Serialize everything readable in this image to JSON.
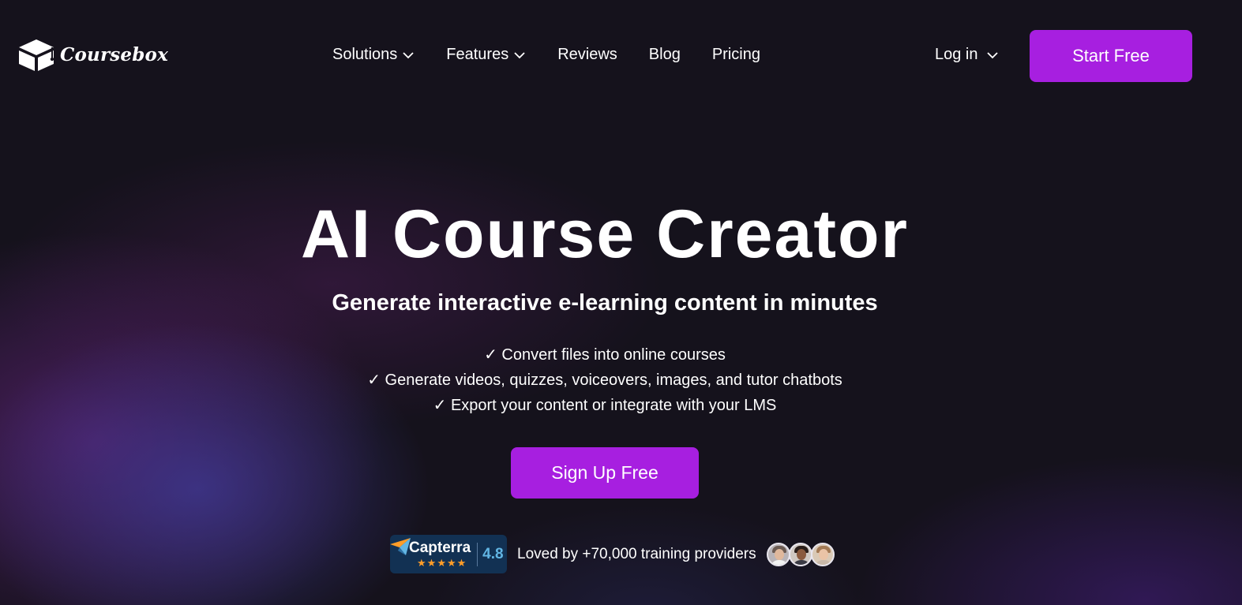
{
  "brand": {
    "name": "Coursebox",
    "icon": "graduation-box-icon"
  },
  "nav": {
    "items": [
      {
        "label": "Solutions",
        "has_dropdown": true
      },
      {
        "label": "Features",
        "has_dropdown": true
      },
      {
        "label": "Reviews",
        "has_dropdown": false
      },
      {
        "label": "Blog",
        "has_dropdown": false
      },
      {
        "label": "Pricing",
        "has_dropdown": false
      }
    ],
    "login_label": "Log in",
    "start_free_label": "Start Free"
  },
  "hero": {
    "title": "AI Course Creator",
    "subtitle": "Generate interactive e-learning content in minutes",
    "features": [
      "✓ Convert files into online courses",
      "✓ Generate videos, quizzes, voiceovers, images, and tutor chatbots",
      "✓ Export your content or integrate with your LMS"
    ],
    "cta_label": "Sign Up Free"
  },
  "proof": {
    "badge_name": "Capterra",
    "badge_score": "4.8",
    "badge_stars": 5,
    "text": "Loved by +70,000 training providers",
    "avatar_count": 3
  },
  "colors": {
    "background": "#15121c",
    "accent": "#a71fe0",
    "capterra_bg": "#123153",
    "capterra_score": "#62b6e4",
    "star": "#ff9d28"
  }
}
